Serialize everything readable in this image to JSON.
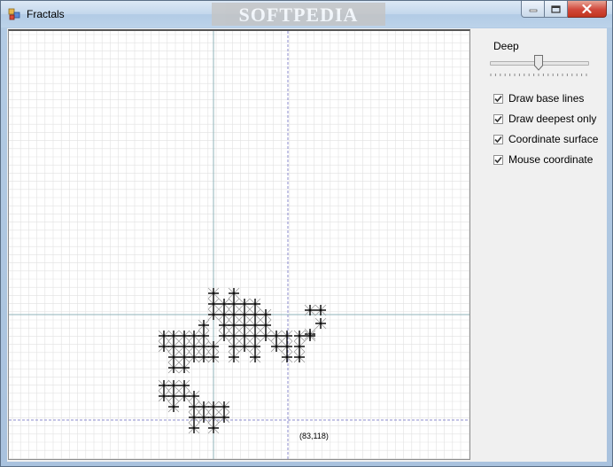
{
  "window": {
    "title": "Fractals",
    "watermark": "SOFTPEDIA"
  },
  "canvas": {
    "mouse_coordinate": "(83,118)"
  },
  "panel": {
    "deep_label": "Deep",
    "deep_value": 0.5,
    "checkboxes": [
      {
        "label": "Draw base lines",
        "checked": true
      },
      {
        "label": "Draw deepest only",
        "checked": true
      },
      {
        "label": "Coordinate surface",
        "checked": true
      },
      {
        "label": "Mouse coordinate",
        "checked": true
      }
    ]
  },
  "colors": {
    "grid": "#e1e1e1",
    "axis": "#8fb3b8",
    "mouse_line": "#8d8dcf",
    "fractal": "#000000",
    "base_lines": "#9a9a9a"
  }
}
